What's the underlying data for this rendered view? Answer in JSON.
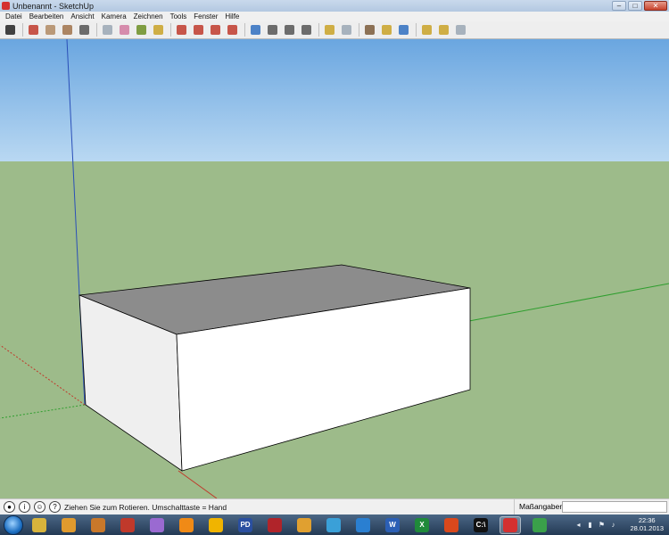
{
  "window": {
    "title": "Unbenannt - SketchUp",
    "minimize": "–",
    "maximize": "□",
    "close": "✕"
  },
  "menu": [
    "Datei",
    "Bearbeiten",
    "Ansicht",
    "Kamera",
    "Zeichnen",
    "Tools",
    "Fenster",
    "Hilfe"
  ],
  "toolbar": {
    "tools": [
      {
        "name": "select-icon",
        "color": "#222222"
      },
      {
        "name": "line-icon",
        "color": "#c0392b"
      },
      {
        "name": "rectangle-icon",
        "color": "#b08a63"
      },
      {
        "name": "circle-icon",
        "color": "#a0724a"
      },
      {
        "name": "arc-icon",
        "color": "#555555"
      },
      {
        "name": "make-component-icon",
        "color": "#9aa7b4"
      },
      {
        "name": "eraser-icon",
        "color": "#d17aa0"
      },
      {
        "name": "paint-bucket-icon",
        "color": "#6b8e23"
      },
      {
        "name": "push-pull-icon",
        "color": "#c9a227"
      },
      {
        "name": "move-icon",
        "color": "#c0392b"
      },
      {
        "name": "rotate-icon",
        "color": "#c0392b"
      },
      {
        "name": "follow-me-icon",
        "color": "#c0392b"
      },
      {
        "name": "offset-icon",
        "color": "#c0392b"
      },
      {
        "name": "orbit-icon",
        "color": "#2f6fbf"
      },
      {
        "name": "pan-icon",
        "color": "#555555"
      },
      {
        "name": "zoom-icon",
        "color": "#555555"
      },
      {
        "name": "zoom-extents-icon",
        "color": "#555555"
      },
      {
        "name": "previous-view-icon",
        "color": "#c9a227"
      },
      {
        "name": "next-view-icon",
        "color": "#9aa7b4"
      },
      {
        "name": "position-camera-icon",
        "color": "#7a5a3a"
      },
      {
        "name": "walk-icon",
        "color": "#c9a227"
      },
      {
        "name": "look-around-icon",
        "color": "#2f6fbf"
      },
      {
        "name": "get-models-icon",
        "color": "#c9a227"
      },
      {
        "name": "share-model-icon",
        "color": "#c9a227"
      },
      {
        "name": "share-component-icon",
        "color": "#9aa7b4"
      }
    ]
  },
  "scene": {
    "sky_color": "#7fb2e3",
    "ground_color": "#9dbb8a",
    "box_top_color": "#8c8c8c",
    "box_front_color": "#ffffff",
    "box_side_color": "#efefef",
    "axis_red": "#c0392b",
    "axis_green": "#2e9e2e",
    "axis_blue": "#2a4fb8"
  },
  "status": {
    "message": "Ziehen Sie zum Rotieren.  Umschalttaste = Hand",
    "measure_label": "Maßangaben",
    "measure_value": ""
  },
  "taskbar": {
    "apps": [
      {
        "name": "taskbar-explorer",
        "label": "",
        "color": "#d8b43c"
      },
      {
        "name": "taskbar-firefox-old",
        "label": "",
        "color": "#e09a2e"
      },
      {
        "name": "taskbar-app-3",
        "label": "",
        "color": "#c9782a"
      },
      {
        "name": "taskbar-app-4",
        "label": "",
        "color": "#c0392b"
      },
      {
        "name": "taskbar-media-player",
        "label": "",
        "color": "#9a6ad1"
      },
      {
        "name": "taskbar-vlc",
        "label": "",
        "color": "#f08a16"
      },
      {
        "name": "taskbar-app-7",
        "label": "",
        "color": "#f0b400"
      },
      {
        "name": "taskbar-pd",
        "label": "PD",
        "color": "#2a4fa0"
      },
      {
        "name": "taskbar-app-9",
        "label": "",
        "color": "#b0242a"
      },
      {
        "name": "taskbar-app-10",
        "label": "",
        "color": "#e0a030"
      },
      {
        "name": "taskbar-app-11",
        "label": "",
        "color": "#3aa0d8"
      },
      {
        "name": "taskbar-app-12",
        "label": "",
        "color": "#2a7fd1"
      },
      {
        "name": "taskbar-word",
        "label": "W",
        "color": "#2b5fb5"
      },
      {
        "name": "taskbar-excel",
        "label": "X",
        "color": "#1f8a3a"
      },
      {
        "name": "taskbar-app-15",
        "label": "",
        "color": "#d9481c"
      },
      {
        "name": "taskbar-cmd",
        "label": "C:\\",
        "color": "#111111"
      },
      {
        "name": "taskbar-sketchup",
        "label": "",
        "color": "#d43030",
        "active": true
      },
      {
        "name": "taskbar-app-18",
        "label": "",
        "color": "#3aa04a"
      }
    ],
    "time": "22:36",
    "date": "28.01.2013"
  }
}
